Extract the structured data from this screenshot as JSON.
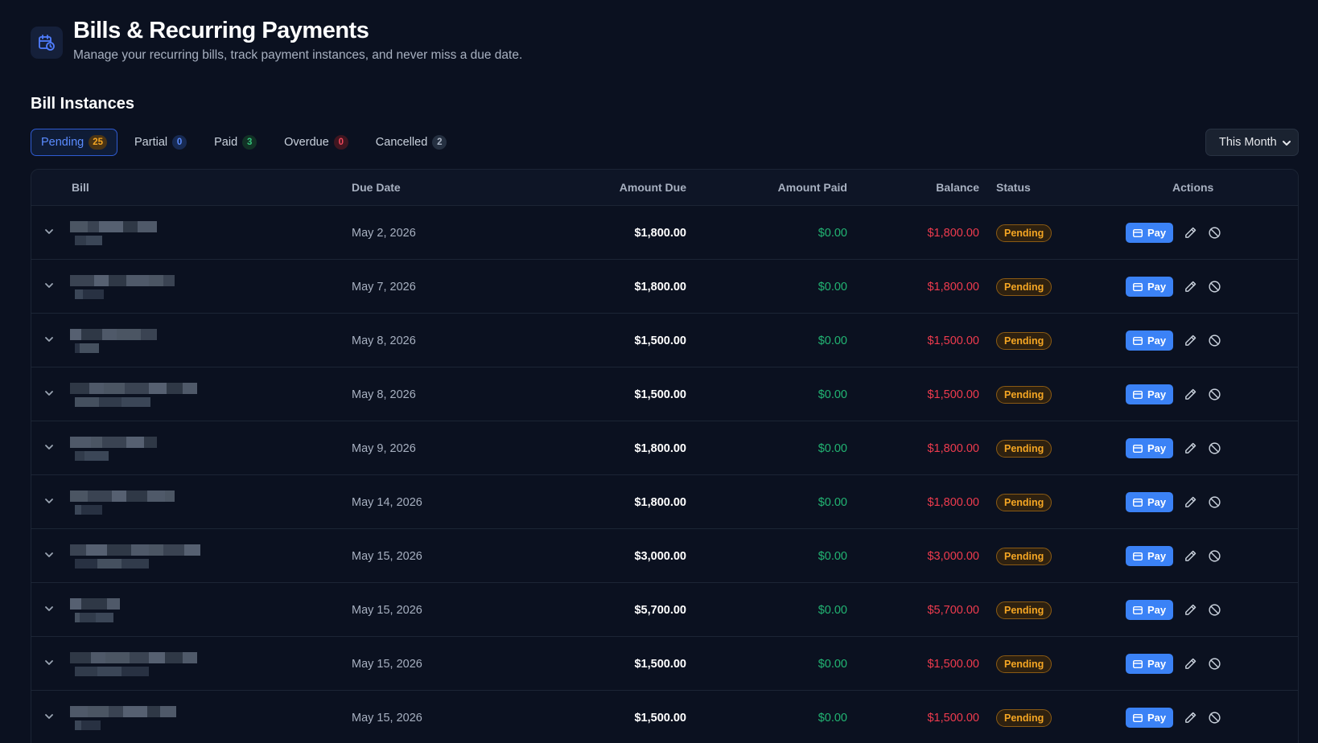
{
  "header": {
    "title": "Bills & Recurring Payments",
    "subtitle": "Manage your recurring bills, track payment instances, and never miss a due date.",
    "icon": "calendar-clock-icon"
  },
  "section": {
    "title": "Bill Instances"
  },
  "tabs": [
    {
      "label": "Pending",
      "count": "25",
      "active": true
    },
    {
      "label": "Partial",
      "count": "0"
    },
    {
      "label": "Paid",
      "count": "3"
    },
    {
      "label": "Overdue",
      "count": "0"
    },
    {
      "label": "Cancelled",
      "count": "2"
    }
  ],
  "period": {
    "selected": "This Month"
  },
  "table": {
    "columns": {
      "bill": "Bill",
      "due_date": "Due Date",
      "amount_due": "Amount Due",
      "amount_paid": "Amount Paid",
      "balance": "Balance",
      "status": "Status",
      "actions": "Actions"
    },
    "pay_label": "Pay",
    "rows": [
      {
        "due_date": "May 2, 2026",
        "amount_due": "$1,800.00",
        "amount_paid": "$0.00",
        "balance": "$1,800.00",
        "status": "Pending"
      },
      {
        "due_date": "May 7, 2026",
        "amount_due": "$1,800.00",
        "amount_paid": "$0.00",
        "balance": "$1,800.00",
        "status": "Pending"
      },
      {
        "due_date": "May 8, 2026",
        "amount_due": "$1,500.00",
        "amount_paid": "$0.00",
        "balance": "$1,500.00",
        "status": "Pending"
      },
      {
        "due_date": "May 8, 2026",
        "amount_due": "$1,500.00",
        "amount_paid": "$0.00",
        "balance": "$1,500.00",
        "status": "Pending"
      },
      {
        "due_date": "May 9, 2026",
        "amount_due": "$1,800.00",
        "amount_paid": "$0.00",
        "balance": "$1,800.00",
        "status": "Pending"
      },
      {
        "due_date": "May 14, 2026",
        "amount_due": "$1,800.00",
        "amount_paid": "$0.00",
        "balance": "$1,800.00",
        "status": "Pending"
      },
      {
        "due_date": "May 15, 2026",
        "amount_due": "$3,000.00",
        "amount_paid": "$0.00",
        "balance": "$3,000.00",
        "status": "Pending"
      },
      {
        "due_date": "May 15, 2026",
        "amount_due": "$5,700.00",
        "amount_paid": "$0.00",
        "balance": "$5,700.00",
        "status": "Pending"
      },
      {
        "due_date": "May 15, 2026",
        "amount_due": "$1,500.00",
        "amount_paid": "$0.00",
        "balance": "$1,500.00",
        "status": "Pending"
      },
      {
        "due_date": "May 15, 2026",
        "amount_due": "$1,500.00",
        "amount_paid": "$0.00",
        "balance": "$1,500.00",
        "status": "Pending"
      }
    ]
  },
  "colors": {
    "background": "#0b1120",
    "accent": "#3b82f6",
    "paid_green": "#22b573",
    "balance_red": "#ef3b4e",
    "pending_orange": "#f5a623"
  },
  "icons": {
    "expand": "chevron-down-icon",
    "pay": "credit-card-icon",
    "edit": "pencil-icon",
    "cancel": "ban-icon",
    "select": "chevron-down-icon"
  }
}
